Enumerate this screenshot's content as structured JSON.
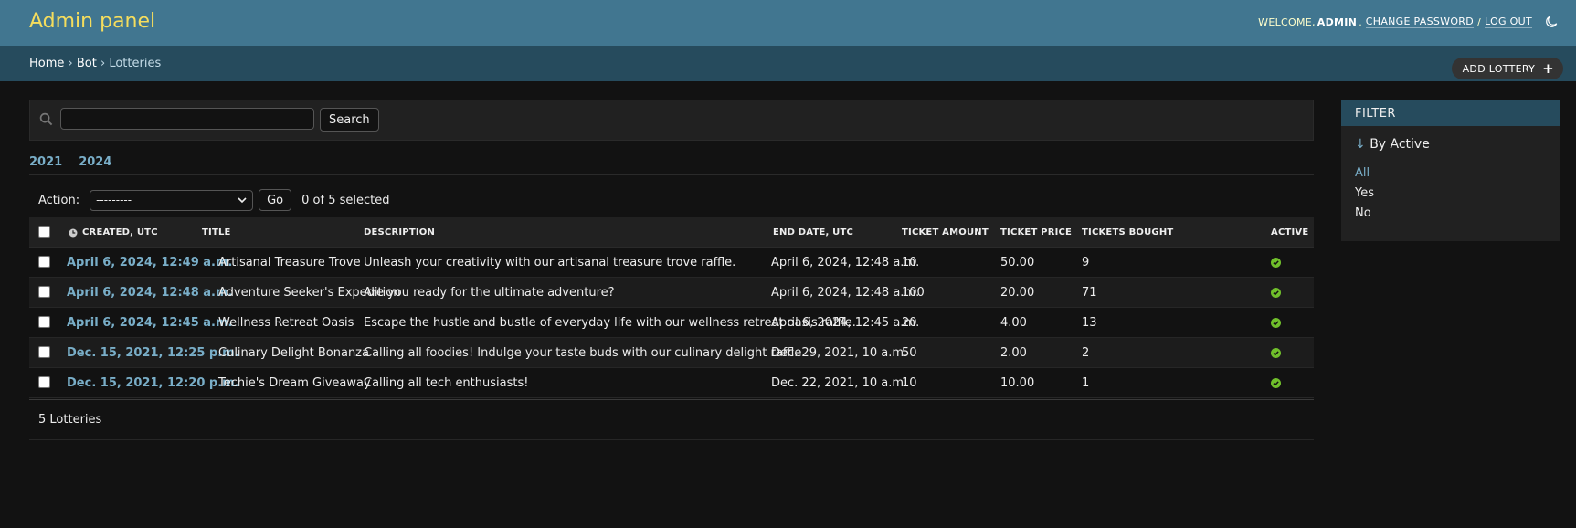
{
  "header": {
    "branding": "Admin panel",
    "welcome": "WELCOME,",
    "username": "ADMIN",
    "change_password": "CHANGE PASSWORD",
    "separator": "/",
    "logout": "LOG OUT",
    "theme_icon": "moon-icon"
  },
  "breadcrumbs": {
    "home": "Home",
    "sep": "›",
    "app": "Bot",
    "current": "Lotteries"
  },
  "add_button": {
    "label": "ADD LOTTERY",
    "plus": "+"
  },
  "search": {
    "value": "",
    "button": "Search"
  },
  "date_hierarchy": [
    "2021",
    "2024"
  ],
  "actions": {
    "label": "Action:",
    "selected": "---------",
    "go": "Go",
    "selection_count": "0 of 5 selected"
  },
  "table": {
    "columns": {
      "created": "CREATED, UTC",
      "title": "TITLE",
      "description": "DESCRIPTION",
      "end_date": "END DATE, UTC",
      "ticket_amount": "TICKET AMOUNT",
      "ticket_price": "TICKET PRICE",
      "tickets_bought": "TICKETS BOUGHT",
      "active": "ACTIVE"
    },
    "rows": [
      {
        "created": "April 6, 2024, 12:49 a.m.",
        "title": "Artisanal Treasure Trove",
        "description": "Unleash your creativity with our artisanal treasure trove raffle.",
        "end_date": "April 6, 2024, 12:48 a.m.",
        "ticket_amount": "10",
        "ticket_price": "50.00",
        "tickets_bought": "9",
        "active": true
      },
      {
        "created": "April 6, 2024, 12:48 a.m.",
        "title": "Adventure Seeker's Expedition",
        "description": "Are you ready for the ultimate adventure?",
        "end_date": "April 6, 2024, 12:48 a.m.",
        "ticket_amount": "100",
        "ticket_price": "20.00",
        "tickets_bought": "71",
        "active": true
      },
      {
        "created": "April 6, 2024, 12:45 a.m.",
        "title": "Wellness Retreat Oasis",
        "description": "Escape the hustle and bustle of everyday life with our wellness retreat oasis raffle.",
        "end_date": "April 6, 2024, 12:45 a.m.",
        "ticket_amount": "20",
        "ticket_price": "4.00",
        "tickets_bought": "13",
        "active": true
      },
      {
        "created": "Dec. 15, 2021, 12:25 p.m.",
        "title": "Culinary Delight Bonanza",
        "description": "Calling all foodies! Indulge your taste buds with our culinary delight raffle.",
        "end_date": "Dec. 29, 2021, 10 a.m.",
        "ticket_amount": "50",
        "ticket_price": "2.00",
        "tickets_bought": "2",
        "active": true
      },
      {
        "created": "Dec. 15, 2021, 12:20 p.m.",
        "title": "Techie's Dream Giveaway",
        "description": "Calling all tech enthusiasts!",
        "end_date": "Dec. 22, 2021, 10 a.m.",
        "ticket_amount": "10",
        "ticket_price": "10.00",
        "tickets_bought": "1",
        "active": true
      }
    ]
  },
  "paginator": "5 Lotteries",
  "filter": {
    "heading": "FILTER",
    "arrow": "↓",
    "title": "By Active",
    "options": [
      "All",
      "Yes",
      "No"
    ],
    "selected": "All"
  },
  "colors": {
    "header": "#417690",
    "branding": "#f5dd5d",
    "breadcrumbs": "#264b5d",
    "link": "#79aec8",
    "active_icon": "#70bf2b"
  }
}
